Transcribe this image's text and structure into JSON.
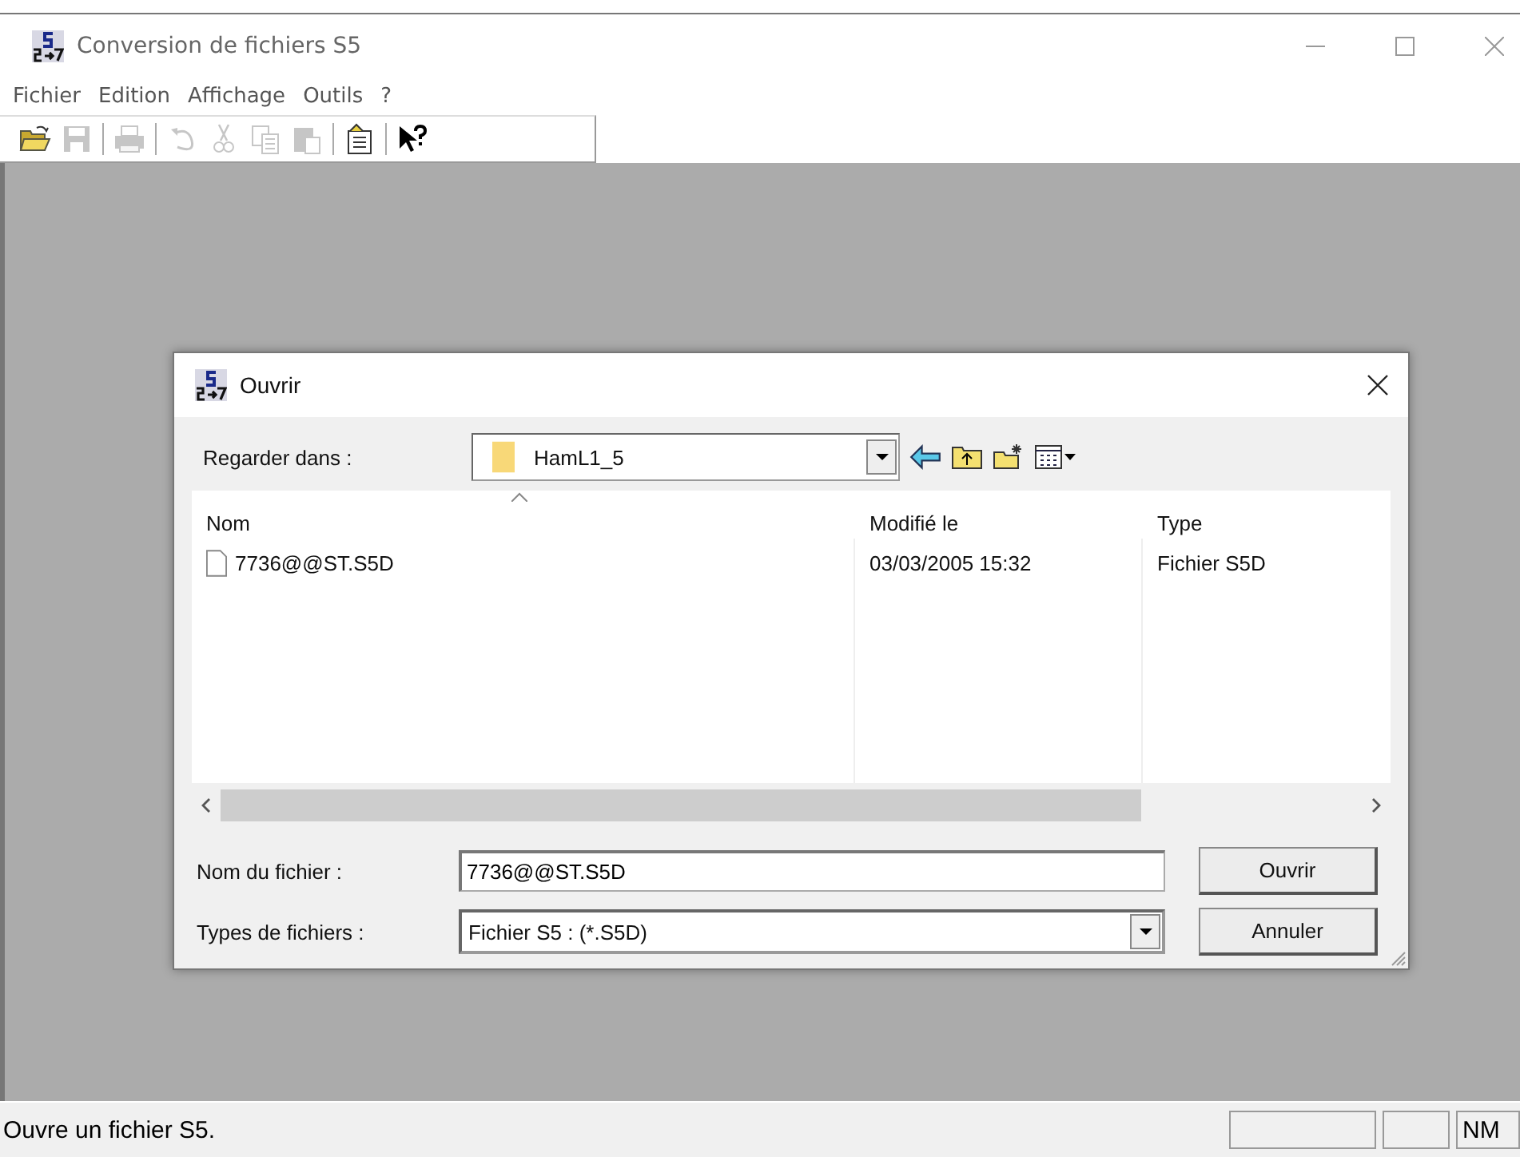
{
  "window": {
    "title": "Conversion de fichiers S5"
  },
  "menu": [
    "Fichier",
    "Edition",
    "Affichage",
    "Outils",
    "?"
  ],
  "toolbar": [
    {
      "kind": "open",
      "disabled": false
    },
    {
      "kind": "save",
      "disabled": true
    },
    {
      "kind": "separator"
    },
    {
      "kind": "print",
      "disabled": true
    },
    {
      "kind": "separator"
    },
    {
      "kind": "undo",
      "disabled": true
    },
    {
      "kind": "cut",
      "disabled": true
    },
    {
      "kind": "copy",
      "disabled": true
    },
    {
      "kind": "paste",
      "disabled": true
    },
    {
      "kind": "separator"
    },
    {
      "kind": "notes",
      "disabled": false
    },
    {
      "kind": "separator"
    },
    {
      "kind": "help",
      "disabled": false
    }
  ],
  "dialog": {
    "title": "Ouvrir",
    "look_in_label": "Regarder dans :",
    "look_in_value": "HamL1_5",
    "columns": [
      "Nom",
      "Modifié le",
      "Type"
    ],
    "files": [
      {
        "name": "7736@@ST.S5D",
        "modified": "03/03/2005 15:32",
        "type": "Fichier S5D"
      }
    ],
    "filename_label": "Nom du fichier :",
    "filename_value": "7736@@ST.S5D",
    "filetype_label": "Types de fichiers :",
    "filetype_value": "Fichier S5 : (*.S5D)",
    "buttons": [
      "Ouvrir",
      "Annuler"
    ]
  },
  "status_bar": {
    "message": "Ouvre un fichier S5.",
    "indicator": "NM"
  }
}
